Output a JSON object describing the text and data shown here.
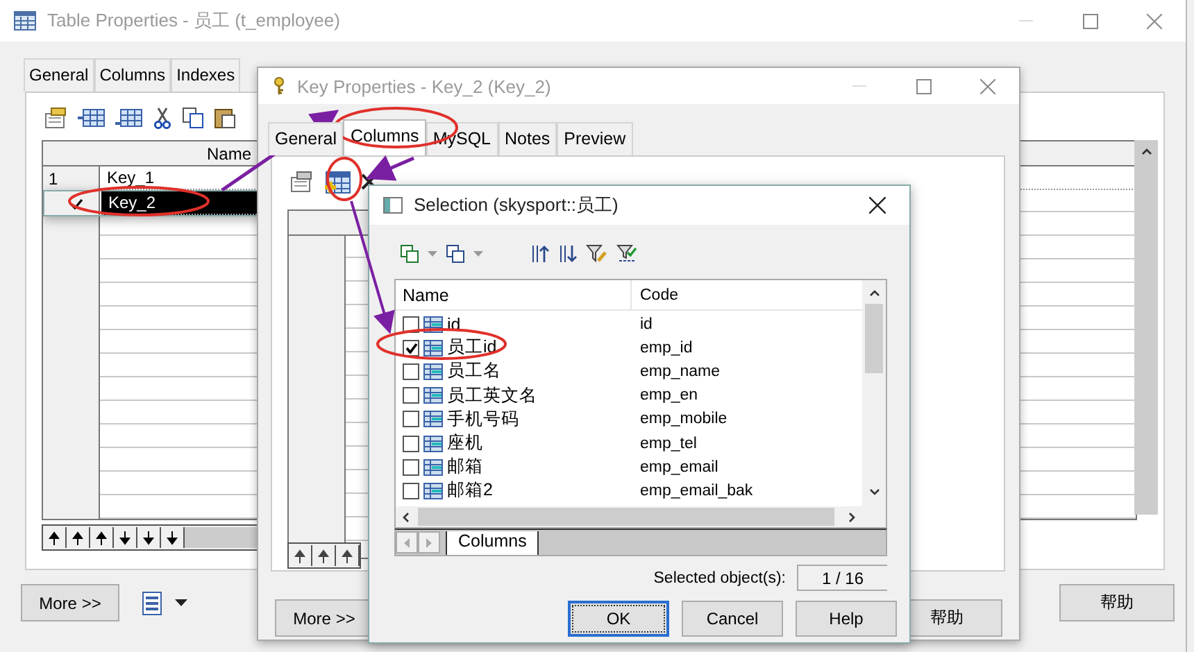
{
  "table_window": {
    "title": "Table Properties - 员工 (t_employee)",
    "tabs": [
      {
        "label": "General",
        "selected": false
      },
      {
        "label": "Columns",
        "selected": false
      },
      {
        "label": "Indexes",
        "selected": false
      }
    ],
    "grid": {
      "column": "Name",
      "rows": [
        {
          "number": "1",
          "name": "Key_1",
          "selected": false
        },
        {
          "number": "",
          "name": "Key_2",
          "selected": true
        }
      ]
    },
    "buttons": [
      "More >>",
      "帮助"
    ]
  },
  "key_window": {
    "title": "Key Properties - Key_2 (Key_2)",
    "tabs": [
      {
        "label": "General",
        "selected": false
      },
      {
        "label": "Columns",
        "selected": true
      },
      {
        "label": "MySQL",
        "selected": false
      },
      {
        "label": "Notes",
        "selected": false
      },
      {
        "label": "Preview",
        "selected": false
      }
    ],
    "buttons": [
      "More >>",
      "帮助"
    ]
  },
  "selection_dialog": {
    "title": "Selection (skysport::员工)",
    "columns": [
      "Name",
      "Code"
    ],
    "rows": [
      {
        "name": "id",
        "code": "id",
        "checked": false
      },
      {
        "name": "员工id",
        "code": "emp_id",
        "checked": true
      },
      {
        "name": "员工名",
        "code": "emp_name",
        "checked": false
      },
      {
        "name": "员工英文名",
        "code": "emp_en",
        "checked": false
      },
      {
        "name": "手机号码",
        "code": "emp_mobile",
        "checked": false
      },
      {
        "name": "座机",
        "code": "emp_tel",
        "checked": false
      },
      {
        "name": "邮箱",
        "code": "emp_email",
        "checked": false
      },
      {
        "name": "邮箱2",
        "code": "emp_email_bak",
        "checked": false
      }
    ],
    "sheet_tab": "Columns",
    "selected_label": "Selected object(s):",
    "selected_count": "1 / 16",
    "buttons": [
      "OK",
      "Cancel",
      "Help"
    ]
  }
}
